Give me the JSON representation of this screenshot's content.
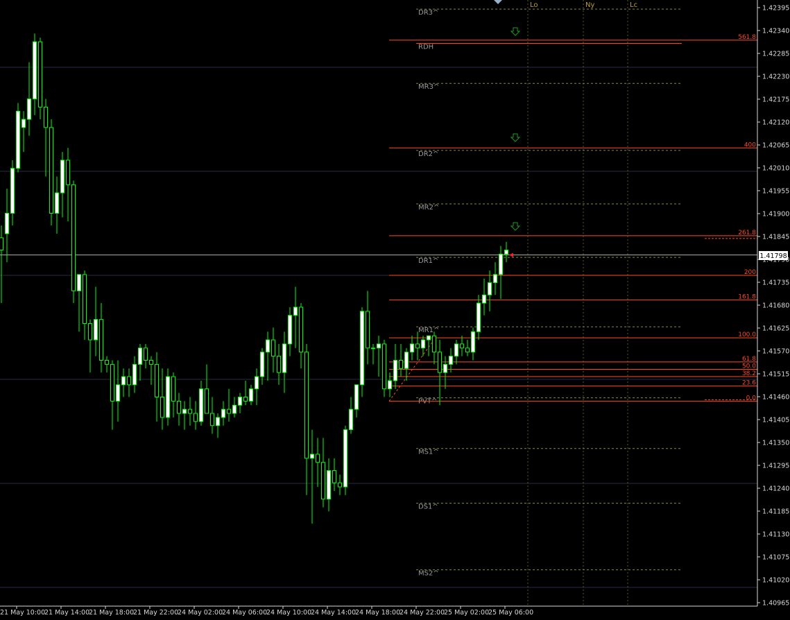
{
  "chart_data": {
    "type": "candlestick",
    "title": "",
    "colors": {
      "background": "#000000",
      "bull": "#ffffff",
      "bear": "#000000",
      "wick": "#00ff00",
      "axis": "#d8d8d8",
      "grid": "#2a2d4a",
      "pivot_line": "#8a8a3a",
      "fib_line": "#ff4a20",
      "level_text": "#9a9a9a",
      "session_line": "#5a5a20",
      "session_text": "#b8a028",
      "arrow": "#1f9a1f",
      "current_price_line": "#b0b0b0"
    },
    "ylim": [
      1.40938,
      1.42412
    ],
    "y_ticks": [
      "1.42395",
      "1.42340",
      "1.42285",
      "1.42230",
      "1.42175",
      "1.42120",
      "1.42065",
      "1.42010",
      "1.41955",
      "1.41900",
      "1.41845",
      "1.41790",
      "1.41735",
      "1.41680",
      "1.41625",
      "1.41570",
      "1.41515",
      "1.41460",
      "1.41405",
      "1.41350",
      "1.41295",
      "1.41240",
      "1.41185",
      "1.41130",
      "1.41075",
      "1.41020",
      "1.40965"
    ],
    "x_ticks": [
      "21 May 10:00",
      "21 May 14:00",
      "21 May 18:00",
      "21 May 22:00",
      "24 May 02:00",
      "24 May 06:00",
      "24 May 10:00",
      "24 May 14:00",
      "24 May 18:00",
      "24 May 22:00",
      "25 May 02:00",
      "25 May 06:00"
    ],
    "current_price": "1.41798",
    "candles": [
      {
        "o": 1.4184,
        "h": 1.4187,
        "l": 1.4168,
        "c": 1.4181
      },
      {
        "o": 1.4185,
        "h": 1.4196,
        "l": 1.4178,
        "c": 1.419
      },
      {
        "o": 1.419,
        "h": 1.4203,
        "l": 1.4187,
        "c": 1.4201
      },
      {
        "o": 1.4201,
        "h": 1.4217,
        "l": 1.42,
        "c": 1.4215
      },
      {
        "o": 1.4211,
        "h": 1.4215,
        "l": 1.4205,
        "c": 1.4213
      },
      {
        "o": 1.4213,
        "h": 1.4227,
        "l": 1.4209,
        "c": 1.4218
      },
      {
        "o": 1.4218,
        "h": 1.4234,
        "l": 1.4214,
        "c": 1.4232
      },
      {
        "o": 1.4232,
        "h": 1.4233,
        "l": 1.4213,
        "c": 1.4216
      },
      {
        "o": 1.4216,
        "h": 1.4218,
        "l": 1.4199,
        "c": 1.4211
      },
      {
        "o": 1.4211,
        "h": 1.4213,
        "l": 1.4187,
        "c": 1.419
      },
      {
        "o": 1.419,
        "h": 1.4199,
        "l": 1.4185,
        "c": 1.4195
      },
      {
        "o": 1.4195,
        "h": 1.4205,
        "l": 1.4189,
        "c": 1.4203
      },
      {
        "o": 1.4203,
        "h": 1.4206,
        "l": 1.4188,
        "c": 1.4197
      },
      {
        "o": 1.4197,
        "h": 1.4198,
        "l": 1.4168,
        "c": 1.4171
      },
      {
        "o": 1.4171,
        "h": 1.4175,
        "l": 1.4161,
        "c": 1.4175
      },
      {
        "o": 1.4175,
        "h": 1.4176,
        "l": 1.4159,
        "c": 1.4163
      },
      {
        "o": 1.4163,
        "h": 1.4164,
        "l": 1.4151,
        "c": 1.4159
      },
      {
        "o": 1.4159,
        "h": 1.4172,
        "l": 1.4155,
        "c": 1.4164
      },
      {
        "o": 1.4164,
        "h": 1.4168,
        "l": 1.4151,
        "c": 1.4154
      },
      {
        "o": 1.4154,
        "h": 1.4155,
        "l": 1.4151,
        "c": 1.4153
      },
      {
        "o": 1.4153,
        "h": 1.4154,
        "l": 1.4137,
        "c": 1.4144
      },
      {
        "o": 1.4144,
        "h": 1.4154,
        "l": 1.4139,
        "c": 1.4148
      },
      {
        "o": 1.4148,
        "h": 1.4152,
        "l": 1.4145,
        "c": 1.415
      },
      {
        "o": 1.415,
        "h": 1.4152,
        "l": 1.4145,
        "c": 1.4148
      },
      {
        "o": 1.4148,
        "h": 1.4155,
        "l": 1.4146,
        "c": 1.4153
      },
      {
        "o": 1.4153,
        "h": 1.4158,
        "l": 1.4149,
        "c": 1.4157
      },
      {
        "o": 1.4157,
        "h": 1.4158,
        "l": 1.4152,
        "c": 1.4154
      },
      {
        "o": 1.4154,
        "h": 1.4155,
        "l": 1.4148,
        "c": 1.4153
      },
      {
        "o": 1.4153,
        "h": 1.4156,
        "l": 1.4139,
        "c": 1.4145
      },
      {
        "o": 1.4145,
        "h": 1.4152,
        "l": 1.4137,
        "c": 1.414
      },
      {
        "o": 1.414,
        "h": 1.4152,
        "l": 1.4138,
        "c": 1.415
      },
      {
        "o": 1.415,
        "h": 1.4151,
        "l": 1.414,
        "c": 1.4144
      },
      {
        "o": 1.4144,
        "h": 1.4146,
        "l": 1.4138,
        "c": 1.4141
      },
      {
        "o": 1.4141,
        "h": 1.4144,
        "l": 1.4137,
        "c": 1.4142
      },
      {
        "o": 1.4142,
        "h": 1.4145,
        "l": 1.4138,
        "c": 1.4141
      },
      {
        "o": 1.4141,
        "h": 1.4144,
        "l": 1.4137,
        "c": 1.4139
      },
      {
        "o": 1.4139,
        "h": 1.4149,
        "l": 1.4138,
        "c": 1.4147
      },
      {
        "o": 1.4147,
        "h": 1.4153,
        "l": 1.4145,
        "c": 1.4141
      },
      {
        "o": 1.4141,
        "h": 1.4145,
        "l": 1.4136,
        "c": 1.4138
      },
      {
        "o": 1.4138,
        "h": 1.4141,
        "l": 1.4135,
        "c": 1.414
      },
      {
        "o": 1.414,
        "h": 1.4144,
        "l": 1.4138,
        "c": 1.4142
      },
      {
        "o": 1.4142,
        "h": 1.4147,
        "l": 1.4139,
        "c": 1.4141
      },
      {
        "o": 1.4141,
        "h": 1.4145,
        "l": 1.414,
        "c": 1.4143
      },
      {
        "o": 1.4143,
        "h": 1.4146,
        "l": 1.4141,
        "c": 1.4145
      },
      {
        "o": 1.4145,
        "h": 1.4149,
        "l": 1.4143,
        "c": 1.4144
      },
      {
        "o": 1.4144,
        "h": 1.4148,
        "l": 1.4143,
        "c": 1.4147
      },
      {
        "o": 1.4147,
        "h": 1.4152,
        "l": 1.4143,
        "c": 1.415
      },
      {
        "o": 1.415,
        "h": 1.4157,
        "l": 1.4148,
        "c": 1.4156
      },
      {
        "o": 1.4156,
        "h": 1.4161,
        "l": 1.4149,
        "c": 1.4159
      },
      {
        "o": 1.4159,
        "h": 1.4162,
        "l": 1.4151,
        "c": 1.4155
      },
      {
        "o": 1.4155,
        "h": 1.4158,
        "l": 1.4148,
        "c": 1.4151
      },
      {
        "o": 1.4151,
        "h": 1.4161,
        "l": 1.4146,
        "c": 1.4158
      },
      {
        "o": 1.4158,
        "h": 1.4167,
        "l": 1.4155,
        "c": 1.4165
      },
      {
        "o": 1.4165,
        "h": 1.4172,
        "l": 1.4157,
        "c": 1.4167
      },
      {
        "o": 1.4167,
        "h": 1.4168,
        "l": 1.4152,
        "c": 1.4156
      },
      {
        "o": 1.4156,
        "h": 1.4158,
        "l": 1.4121,
        "c": 1.413
      },
      {
        "o": 1.413,
        "h": 1.4137,
        "l": 1.4114,
        "c": 1.4131
      },
      {
        "o": 1.4131,
        "h": 1.4135,
        "l": 1.4123,
        "c": 1.4129
      },
      {
        "o": 1.4129,
        "h": 1.4135,
        "l": 1.4118,
        "c": 1.412
      },
      {
        "o": 1.412,
        "h": 1.413,
        "l": 1.4117,
        "c": 1.4127
      },
      {
        "o": 1.4127,
        "h": 1.413,
        "l": 1.4122,
        "c": 1.4124
      },
      {
        "o": 1.4124,
        "h": 1.4126,
        "l": 1.4121,
        "c": 1.4123
      },
      {
        "o": 1.4123,
        "h": 1.4138,
        "l": 1.4121,
        "c": 1.4137
      },
      {
        "o": 1.4137,
        "h": 1.4145,
        "l": 1.4136,
        "c": 1.4142
      },
      {
        "o": 1.4142,
        "h": 1.4148,
        "l": 1.414,
        "c": 1.4148
      },
      {
        "o": 1.4148,
        "h": 1.4167,
        "l": 1.4145,
        "c": 1.4166
      },
      {
        "o": 1.4166,
        "h": 1.4171,
        "l": 1.4153,
        "c": 1.4157
      },
      {
        "o": 1.4157,
        "h": 1.4158,
        "l": 1.4153,
        "c": 1.4157
      },
      {
        "o": 1.4157,
        "h": 1.416,
        "l": 1.415,
        "c": 1.4158
      },
      {
        "o": 1.4158,
        "h": 1.4159,
        "l": 1.4145,
        "c": 1.4147
      },
      {
        "o": 1.4147,
        "h": 1.4151,
        "l": 1.4145,
        "c": 1.4149
      },
      {
        "o": 1.4149,
        "h": 1.4158,
        "l": 1.4147,
        "c": 1.4154
      },
      {
        "o": 1.4154,
        "h": 1.4158,
        "l": 1.415,
        "c": 1.4152
      },
      {
        "o": 1.4152,
        "h": 1.4157,
        "l": 1.4149,
        "c": 1.4156
      },
      {
        "o": 1.4156,
        "h": 1.416,
        "l": 1.4154,
        "c": 1.4158
      },
      {
        "o": 1.4158,
        "h": 1.4161,
        "l": 1.4154,
        "c": 1.4157
      },
      {
        "o": 1.4157,
        "h": 1.416,
        "l": 1.4155,
        "c": 1.4159
      },
      {
        "o": 1.4159,
        "h": 1.416,
        "l": 1.4155,
        "c": 1.416
      },
      {
        "o": 1.416,
        "h": 1.4161,
        "l": 1.4153,
        "c": 1.4156
      },
      {
        "o": 1.4156,
        "h": 1.4159,
        "l": 1.4143,
        "c": 1.4151
      },
      {
        "o": 1.4151,
        "h": 1.4155,
        "l": 1.4147,
        "c": 1.4153
      },
      {
        "o": 1.4153,
        "h": 1.4157,
        "l": 1.4151,
        "c": 1.4155
      },
      {
        "o": 1.4155,
        "h": 1.4159,
        "l": 1.4153,
        "c": 1.4158
      },
      {
        "o": 1.4158,
        "h": 1.416,
        "l": 1.4155,
        "c": 1.4157
      },
      {
        "o": 1.4157,
        "h": 1.4159,
        "l": 1.4155,
        "c": 1.4156
      },
      {
        "o": 1.4156,
        "h": 1.4162,
        "l": 1.4154,
        "c": 1.4161
      },
      {
        "o": 1.4161,
        "h": 1.417,
        "l": 1.4159,
        "c": 1.4168
      },
      {
        "o": 1.4168,
        "h": 1.4174,
        "l": 1.4165,
        "c": 1.417
      },
      {
        "o": 1.417,
        "h": 1.4176,
        "l": 1.4166,
        "c": 1.4173
      },
      {
        "o": 1.4173,
        "h": 1.4178,
        "l": 1.417,
        "c": 1.4175
      },
      {
        "o": 1.4175,
        "h": 1.4182,
        "l": 1.4169,
        "c": 1.418
      },
      {
        "o": 1.418,
        "h": 1.4183,
        "l": 1.4178,
        "c": 1.4181
      }
    ],
    "levels": [
      {
        "name": "DR3^",
        "value": 1.424,
        "style": "pivot"
      },
      {
        "name": "RDH",
        "value": 1.42316,
        "style": "pivot"
      },
      {
        "name": "MR3^",
        "value": 1.42218,
        "style": "pivot"
      },
      {
        "name": "DR2^",
        "value": 1.42054,
        "style": "pivot"
      },
      {
        "name": "MR2^",
        "value": 1.41923,
        "style": "pivot"
      },
      {
        "name": "DR1^",
        "value": 1.41792,
        "style": "pivot"
      },
      {
        "name": "MR1^",
        "value": 1.41622,
        "style": "pivot"
      },
      {
        "name": "PVT^",
        "value": 1.41448,
        "style": "pivot"
      },
      {
        "name": "MS1^",
        "value": 1.41324,
        "style": "pivot"
      },
      {
        "name": "DS1^",
        "value": 1.4119,
        "style": "pivot"
      },
      {
        "name": "MS2^",
        "value": 1.41027,
        "style": "pivot"
      }
    ],
    "fib_levels": [
      {
        "label": "561.8",
        "value": 1.42324
      },
      {
        "label": "400",
        "value": 1.4206
      },
      {
        "label": "261.8",
        "value": 1.41845
      },
      {
        "label": "200",
        "value": 1.41748
      },
      {
        "label": "161.8",
        "value": 1.41688
      },
      {
        "label": "100.0",
        "value": 1.41595
      },
      {
        "label": "61.8",
        "value": 1.41536
      },
      {
        "label": "50.0",
        "value": 1.41518
      },
      {
        "label": "38.2",
        "value": 1.415
      },
      {
        "label": "23.6",
        "value": 1.41477
      },
      {
        "label": "0.0",
        "value": 1.4144
      }
    ],
    "sessions": [
      "Lo",
      "Ny",
      "Lc"
    ]
  }
}
